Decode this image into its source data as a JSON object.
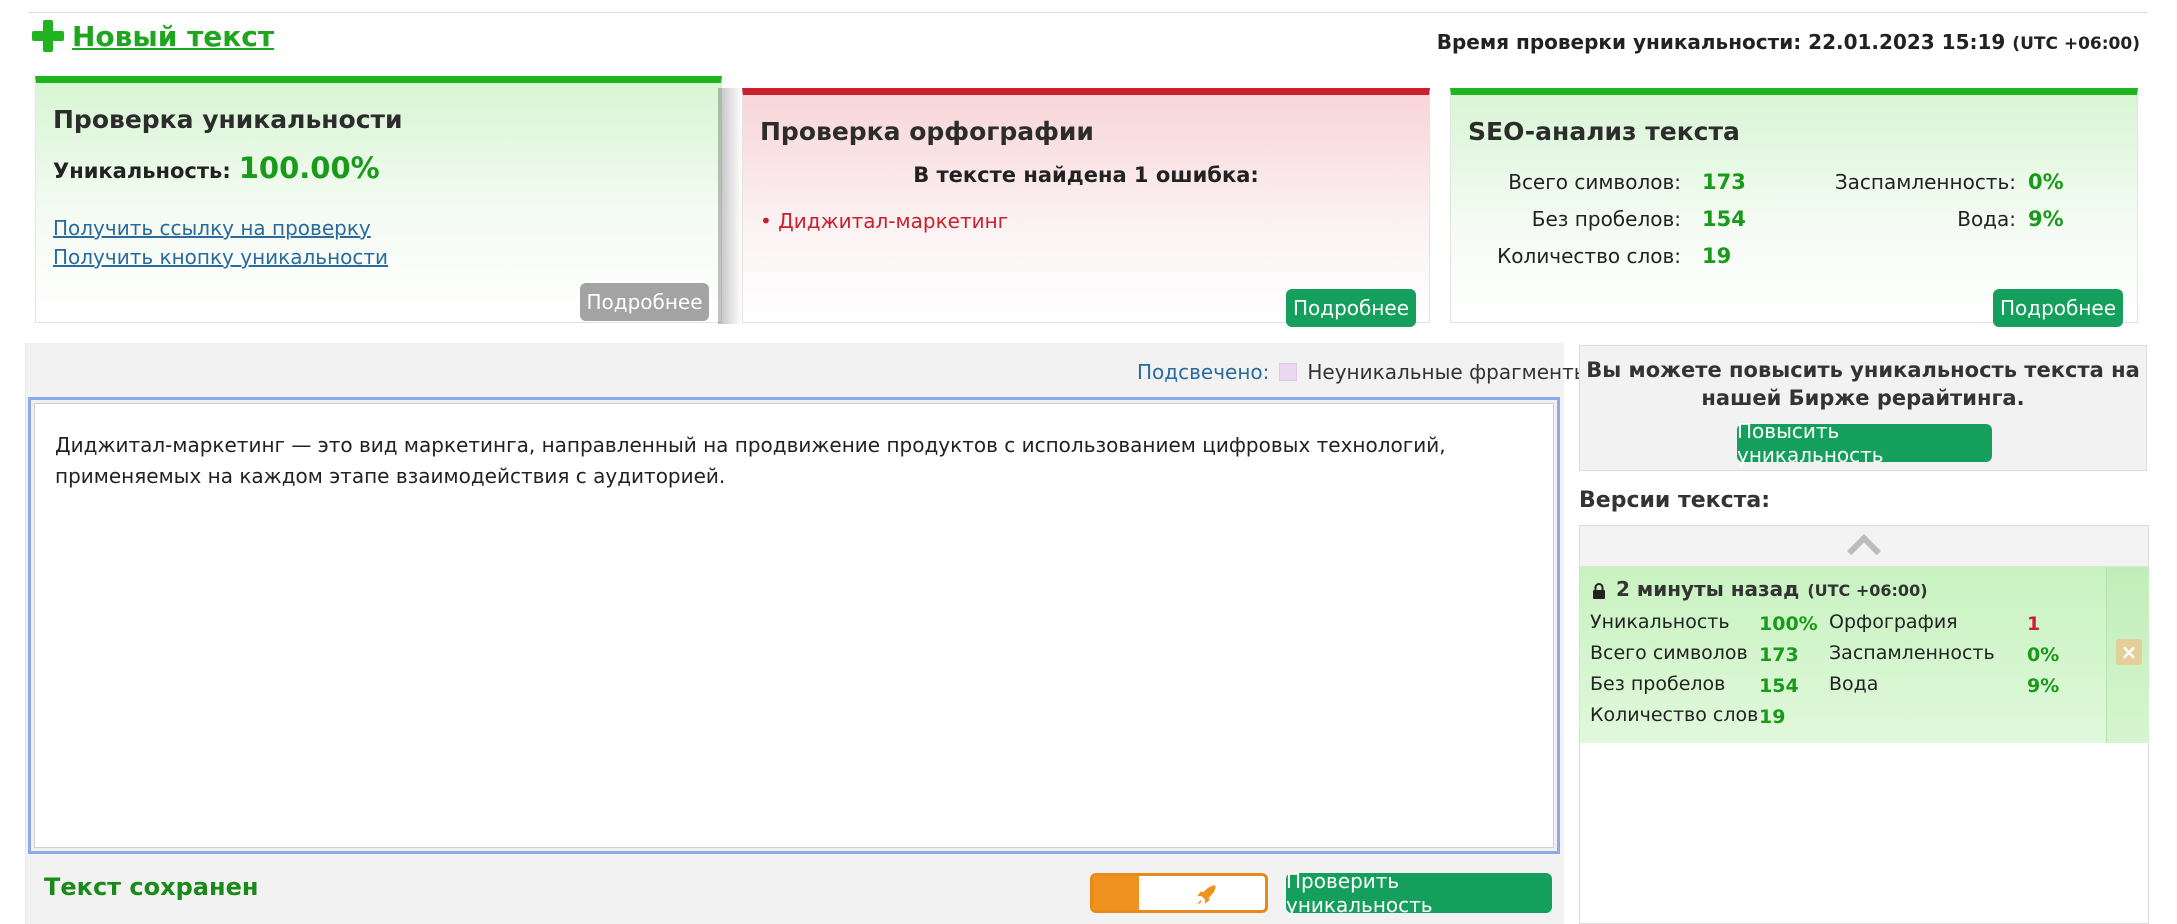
{
  "header": {
    "new_text_label": "Новый текст",
    "check_time_label": "Время проверки уникальности: 22.01.2023 15:19",
    "check_time_tz": "(UTC +06:00)"
  },
  "uniqueness_card": {
    "title": "Проверка уникальности",
    "uniqueness_label": "Уникальность:",
    "uniqueness_value": "100.00%",
    "link_report": "Получить ссылку на проверку",
    "link_button": "Получить кнопку уникальности",
    "details_button": "Подробнее"
  },
  "spelling_card": {
    "title": "Проверка орфографии",
    "found_text": "В тексте найдена 1 ошибка:",
    "errors": [
      "• Диджитал-маркетинг"
    ],
    "details_button": "Подробнее"
  },
  "seo_card": {
    "title": "SEO-анализ текста",
    "total_chars_label": "Всего символов:",
    "total_chars_value": "173",
    "no_spaces_label": "Без пробелов:",
    "no_spaces_value": "154",
    "word_count_label": "Количество слов:",
    "word_count_value": "19",
    "spam_label": "Заспамленность:",
    "spam_value": "0%",
    "water_label": "Вода:",
    "water_value": "9%",
    "details_button": "Подробнее"
  },
  "editor": {
    "highlight_label": "Подсвечено:",
    "highlight_legend": "Неуникальные фрагменты",
    "text": "Диджитал-маркетинг — это вид маркетинга, направленный на продвижение продуктов с использованием цифровых технологий, применяемых на каждом этапе взаимодействия с аудиторией.",
    "saved_status": "Текст сохранен",
    "check_button": "Проверить уникальность"
  },
  "promo": {
    "text": "Вы можете повысить уникальность текста на нашей Бирже рерайтинга.",
    "button": "Повысить уникальность"
  },
  "versions": {
    "title": "Версии текста:",
    "item": {
      "time": "2 минуты назад",
      "tz": "(UTC +06:00)",
      "uniqueness_label": "Уникальность",
      "uniqueness_value": "100%",
      "spelling_label": "Орфография",
      "spelling_value": "1",
      "total_chars_label": "Всего символов",
      "total_chars_value": "173",
      "spam_label": "Заспамленность",
      "spam_value": "0%",
      "no_spaces_label": "Без пробелов",
      "no_spaces_value": "154",
      "water_label": "Вода",
      "water_value": "9%",
      "word_count_label": "Количество слов",
      "word_count_value": "19"
    }
  },
  "colors": {
    "green_accent": "#1fb51f",
    "red_accent": "#cc1e2c",
    "button_green": "#14a05c",
    "toggle_orange": "#f0921e"
  }
}
